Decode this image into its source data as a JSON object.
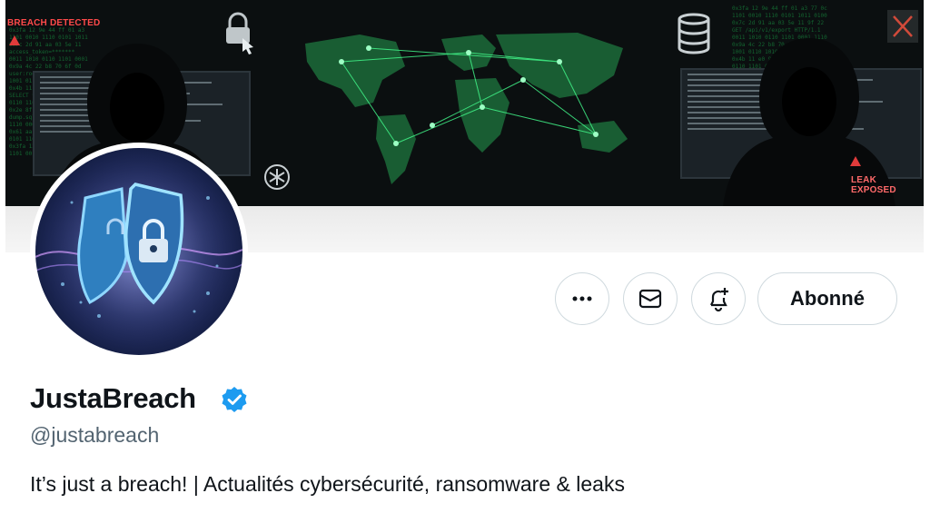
{
  "banner": {
    "alert_left": "BREACH DETECTED",
    "alert_right": "LEAK EXPOSED"
  },
  "actions": {
    "more": "more-icon",
    "message": "envelope-icon",
    "notify": "bell-plus-icon",
    "follow_label": "Abonné"
  },
  "profile": {
    "name": "JustaBreach",
    "handle": "@justabreach",
    "bio": "It’s just a breach! | Actualités cybersécurité, ransomware & leaks",
    "verified": true
  },
  "colors": {
    "verified": "#1d9bf0",
    "banner_green": "#2bd66a",
    "alert_red": "#ff4a4a"
  }
}
